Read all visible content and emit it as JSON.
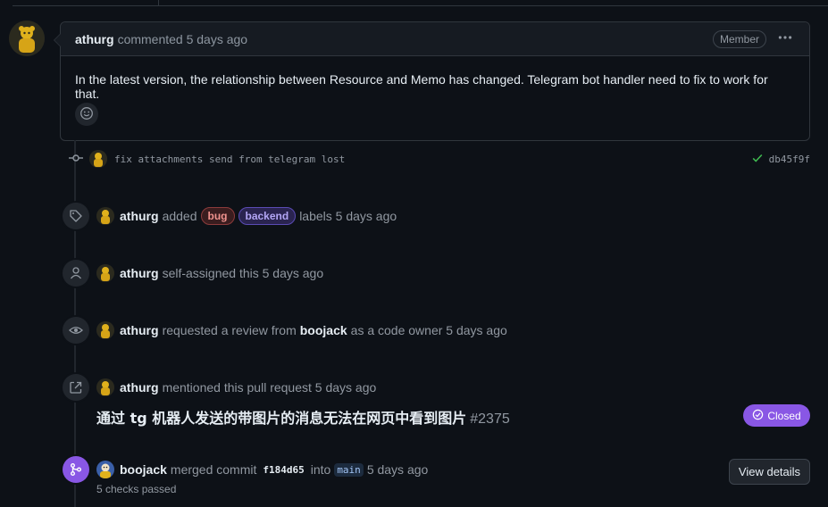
{
  "comment": {
    "author": "athurg",
    "meta": "commented 5 days ago",
    "role_badge": "Member",
    "menu_icon": "kebab-horizontal-icon",
    "body": "In the latest version, the relationship between Resource and Memo has changed. Telegram bot handler need to fix to work for that.",
    "reaction_icon": "smiley-icon"
  },
  "commit": {
    "icon": "git-commit-icon",
    "message": "fix attachments send from telegram lost",
    "status_icon": "check-icon",
    "sha": "db45f9f"
  },
  "events": {
    "labeled": {
      "icon": "tag-icon",
      "actor": "athurg",
      "verb": "added",
      "labels": [
        {
          "name": "bug",
          "color": "#f0938e"
        },
        {
          "name": "backend",
          "color": "#b3a6f5"
        }
      ],
      "suffix": "labels 5 days ago"
    },
    "assigned": {
      "icon": "person-icon",
      "actor": "athurg",
      "text": "self-assigned this 5 days ago"
    },
    "review": {
      "icon": "eye-icon",
      "actor": "athurg",
      "text_before": "requested a review from",
      "reviewer": "boojack",
      "text_after": "as a code owner 5 days ago"
    },
    "mentioned": {
      "icon": "cross-reference-icon",
      "actor": "athurg",
      "text": "mentioned this pull request 5 days ago",
      "pr_title": "通过 tg 机器人发送的带图片的消息无法在网页中看到图片",
      "pr_number": "#2375",
      "state": "Closed",
      "state_color": "#8957e5"
    },
    "merged": {
      "icon": "git-merge-icon",
      "actor": "boojack",
      "verb": "merged commit",
      "commit_sha": "f184d65",
      "into": "into",
      "branch": "main",
      "time": "5 days ago",
      "checks": "5 checks passed",
      "button": "View details"
    }
  },
  "colors": {
    "background": "#0d1117",
    "border": "#30363d",
    "merged_purple": "#8957e5",
    "success_green": "#3fb950"
  }
}
